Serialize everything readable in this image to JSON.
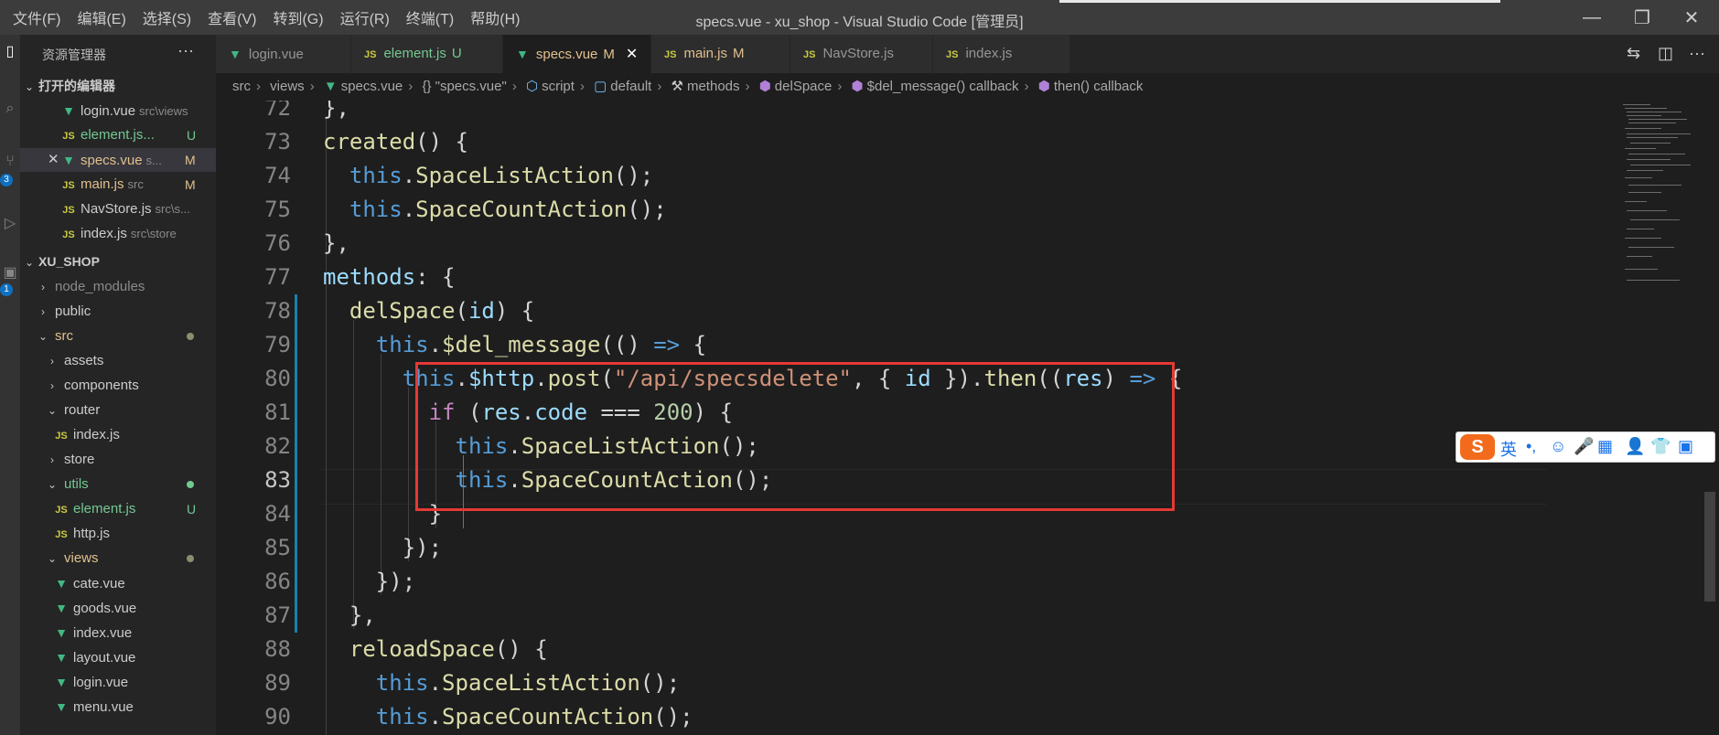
{
  "window": {
    "title": "specs.vue - xu_shop - Visual Studio Code [管理员]",
    "menu": [
      "文件(F)",
      "编辑(E)",
      "选择(S)",
      "查看(V)",
      "转到(G)",
      "运行(R)",
      "终端(T)",
      "帮助(H)"
    ],
    "minimize_glyph": "—",
    "maximize_glyph": "❐",
    "close_glyph": "✕"
  },
  "activity": {
    "scm_badge": "3",
    "ext_badge": "1"
  },
  "sidebar": {
    "title": "资源管理器",
    "more": "···",
    "open_editors_label": "打开的编辑器",
    "open_editors": [
      {
        "icon": "vue",
        "name": "login.vue",
        "desc": "src\\views",
        "badge": ""
      },
      {
        "icon": "js",
        "name": "element.js...",
        "desc": "",
        "badge": "U"
      },
      {
        "icon": "vue",
        "name": "specs.vue",
        "desc": "s...",
        "badge": "M"
      },
      {
        "icon": "js",
        "name": "main.js",
        "desc": "src",
        "badge": "M"
      },
      {
        "icon": "js",
        "name": "NavStore.js",
        "desc": "src\\s...",
        "badge": ""
      },
      {
        "icon": "js",
        "name": "index.js",
        "desc": "src\\store",
        "badge": ""
      }
    ],
    "project_label": "XU_SHOP",
    "tree": [
      {
        "name": "node_modules"
      },
      {
        "name": "public"
      },
      {
        "name": "src"
      },
      {
        "name": "assets"
      },
      {
        "name": "components"
      },
      {
        "name": "router"
      },
      {
        "name": "index.js"
      },
      {
        "name": "store"
      },
      {
        "name": "utils"
      },
      {
        "name": "element.js",
        "badge": "U"
      },
      {
        "name": "http.js"
      },
      {
        "name": "views"
      },
      {
        "name": "cate.vue"
      },
      {
        "name": "goods.vue"
      },
      {
        "name": "index.vue"
      },
      {
        "name": "layout.vue"
      },
      {
        "name": "login.vue"
      },
      {
        "name": "menu.vue"
      }
    ]
  },
  "tabs": [
    {
      "icon": "vue",
      "label": "login.vue",
      "mod": ""
    },
    {
      "icon": "js",
      "label": "element.js",
      "mod": "U"
    },
    {
      "icon": "vue",
      "label": "specs.vue",
      "mod": "M",
      "close": "✕"
    },
    {
      "icon": "js",
      "label": "main.js",
      "mod": "M"
    },
    {
      "icon": "js",
      "label": "NavStore.js",
      "mod": ""
    },
    {
      "icon": "js",
      "label": "index.js",
      "mod": ""
    }
  ],
  "icons": {
    "vue": "▼",
    "js": "JS",
    "chevron_right": "›",
    "chevron_down": "⌄"
  },
  "breadcrumb": [
    "src",
    "views",
    "specs.vue",
    "{} \"specs.vue\"",
    "script",
    "default",
    "methods",
    "delSpace",
    "$del_message() callback",
    "then() callback"
  ],
  "editor": {
    "line_numbers": [
      "72",
      "73",
      "74",
      "75",
      "76",
      "77",
      "78",
      "79",
      "80",
      "81",
      "82",
      "83",
      "84",
      "85",
      "86",
      "87",
      "88",
      "89",
      "90"
    ],
    "current_line": "83"
  },
  "ime": {
    "logo": "S",
    "lang": "英",
    "punct": "•,",
    "emoji": "☺",
    "mic": "🎤",
    "keyboard": "▦",
    "user": "👤",
    "shirt": "👕",
    "grid": "▣"
  }
}
